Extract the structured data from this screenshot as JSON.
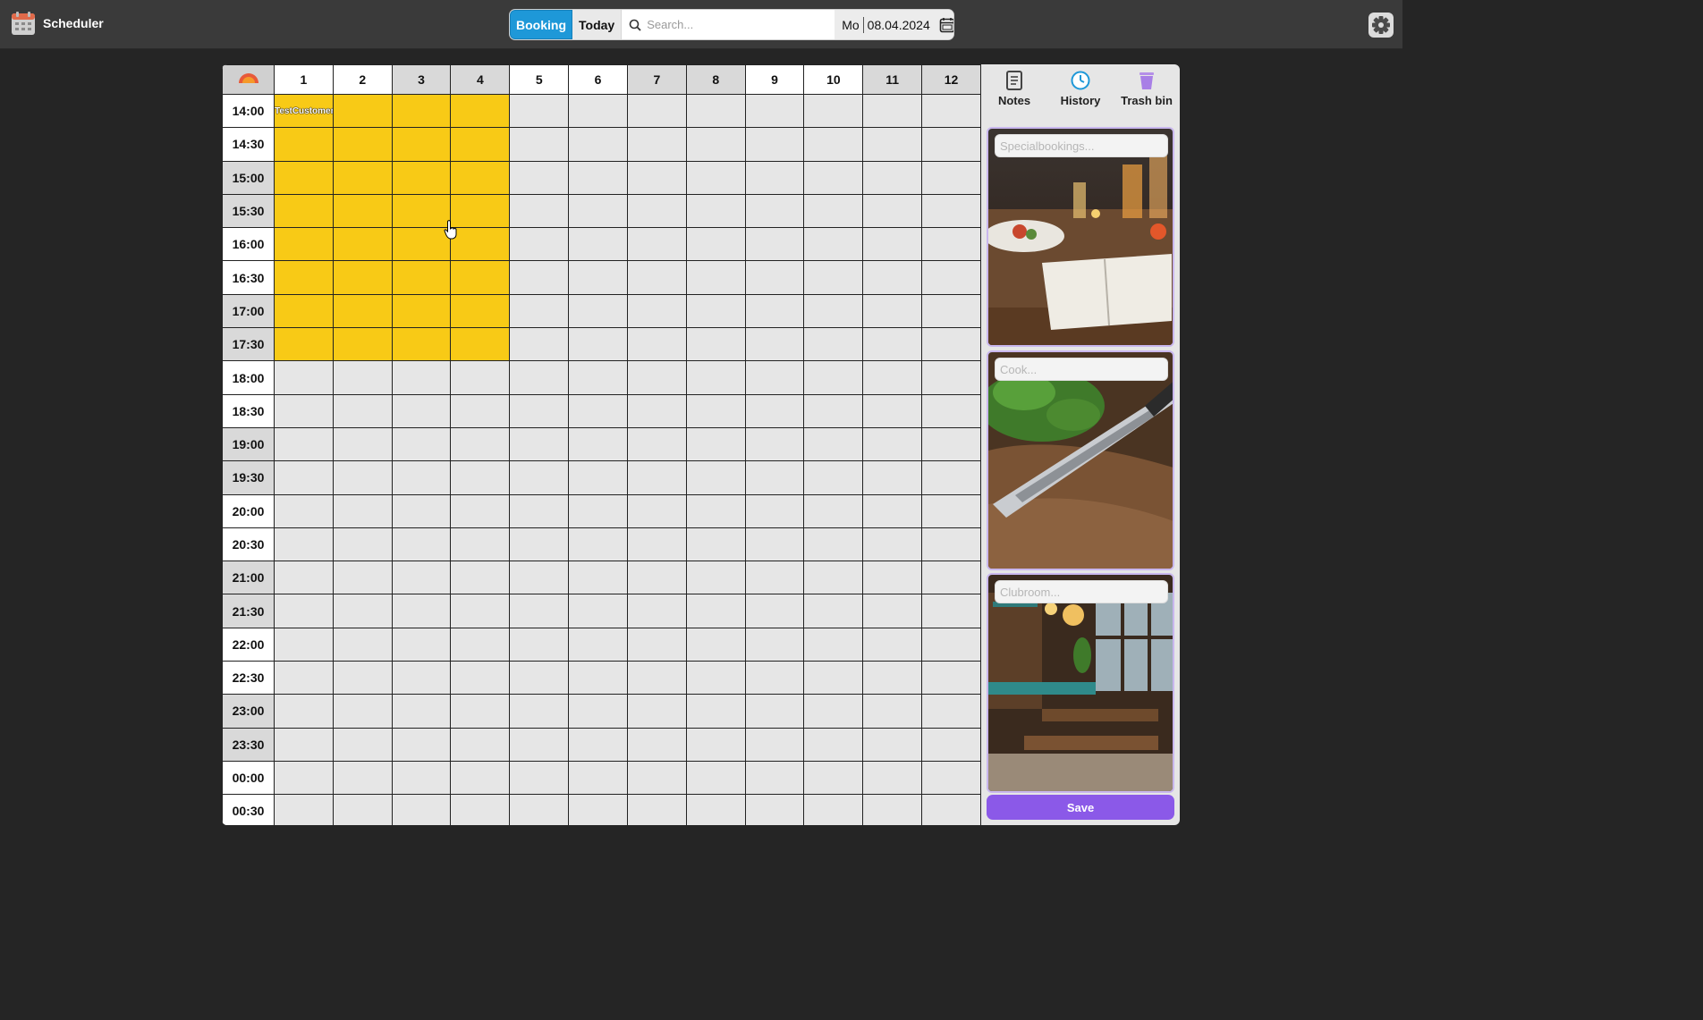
{
  "app": {
    "title": "Scheduler"
  },
  "toolbar": {
    "booking_label": "Booking",
    "today_label": "Today",
    "search_placeholder": "Search...",
    "weekday": "Mo",
    "date": "08.04.2024"
  },
  "grid": {
    "columns": [
      "1",
      "2",
      "3",
      "4",
      "5",
      "6",
      "7",
      "8",
      "9",
      "10",
      "11",
      "12"
    ],
    "shaded_columns": [
      "3",
      "4",
      "7",
      "8",
      "11",
      "12"
    ],
    "times": [
      "14:00",
      "14:30",
      "15:00",
      "15:30",
      "16:00",
      "16:30",
      "17:00",
      "17:30",
      "18:00",
      "18:30",
      "19:00",
      "19:30",
      "20:00",
      "20:30",
      "21:00",
      "21:30",
      "22:00",
      "22:30",
      "23:00",
      "23:30",
      "00:00",
      "00:30"
    ],
    "shaded_times": [
      "15:00",
      "15:30",
      "17:00",
      "17:30",
      "19:00",
      "19:30",
      "21:00",
      "21:30",
      "23:00",
      "23:30"
    ],
    "booking": {
      "label": "TestCustomer",
      "columns": [
        "1",
        "2",
        "3",
        "4"
      ],
      "from": "14:00",
      "to": "17:30",
      "color": "#f8ca16"
    }
  },
  "side": {
    "tabs": [
      {
        "label": "Notes",
        "icon": "notes-icon",
        "active": true
      },
      {
        "label": "History",
        "icon": "clock-icon",
        "active": false
      },
      {
        "label": "Trash bin",
        "icon": "trash-icon",
        "active": false
      }
    ],
    "notes": [
      {
        "placeholder": "Specialbookings...",
        "image": "restaurant-table-menu-image"
      },
      {
        "placeholder": "Cook...",
        "image": "knife-herbs-image"
      },
      {
        "placeholder": "Clubroom...",
        "image": "dining-room-image"
      }
    ],
    "save_label": "Save"
  },
  "colors": {
    "accent": "#1e98d8",
    "booking": "#f8ca16",
    "save": "#8b59e8"
  }
}
